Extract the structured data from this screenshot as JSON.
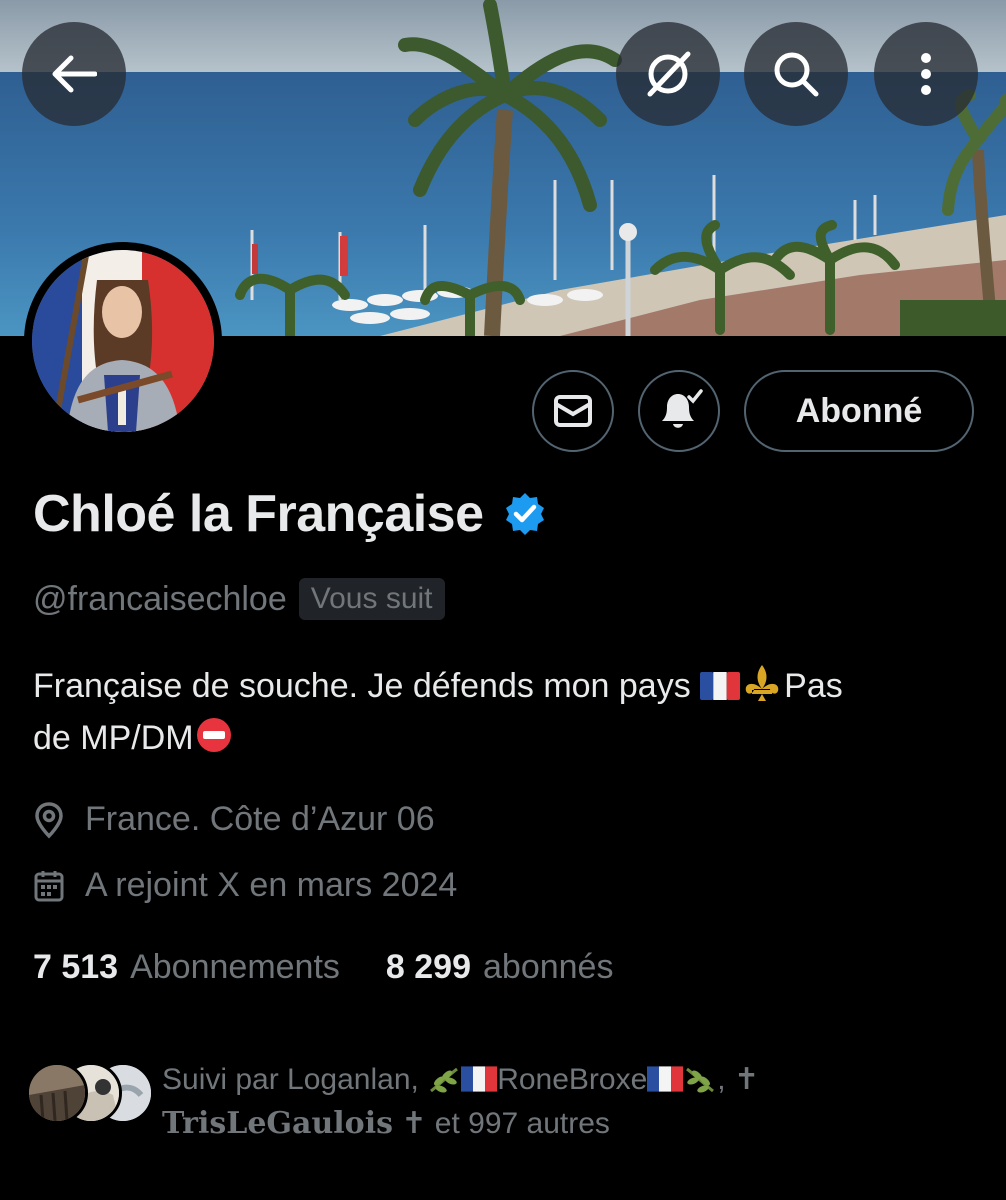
{
  "header": {
    "back_icon": "arrow-left-icon",
    "grok_icon": "grok-icon",
    "search_icon": "search-icon",
    "more_icon": "more-vertical-icon"
  },
  "actions": {
    "message_icon": "mail-icon",
    "notify_icon": "bell-check-icon",
    "follow_label": "Abonné"
  },
  "profile": {
    "name": "Chloé la Française",
    "handle": "@francaisechloe",
    "follows_you": "Vous suit",
    "bio_line1_text": "Française de souche. Je défends mon pays ",
    "bio_line1_end": "Pas",
    "bio_line2_text": "de MP/DM",
    "location": "France. Côte d’Azur 06",
    "joined": "A rejoint X en mars 2024"
  },
  "stats": {
    "following_count": "7 513",
    "following_label": "Abonnements",
    "followers_count": "8 299",
    "followers_label": "abonnés"
  },
  "followed_by": {
    "prefix": "Suivi par Loganlan, ",
    "name2": "RoneBroxe",
    "sep": ", ",
    "cross1": "✝",
    "name3": "TrisLeGaulois",
    "cross2": "✝",
    "suffix": " et 997 autres"
  },
  "colors": {
    "background": "#000000",
    "primary_text": "#e7e9ea",
    "secondary_text": "#71767b",
    "verified_blue": "#1d9bf0",
    "border": "#536471"
  }
}
